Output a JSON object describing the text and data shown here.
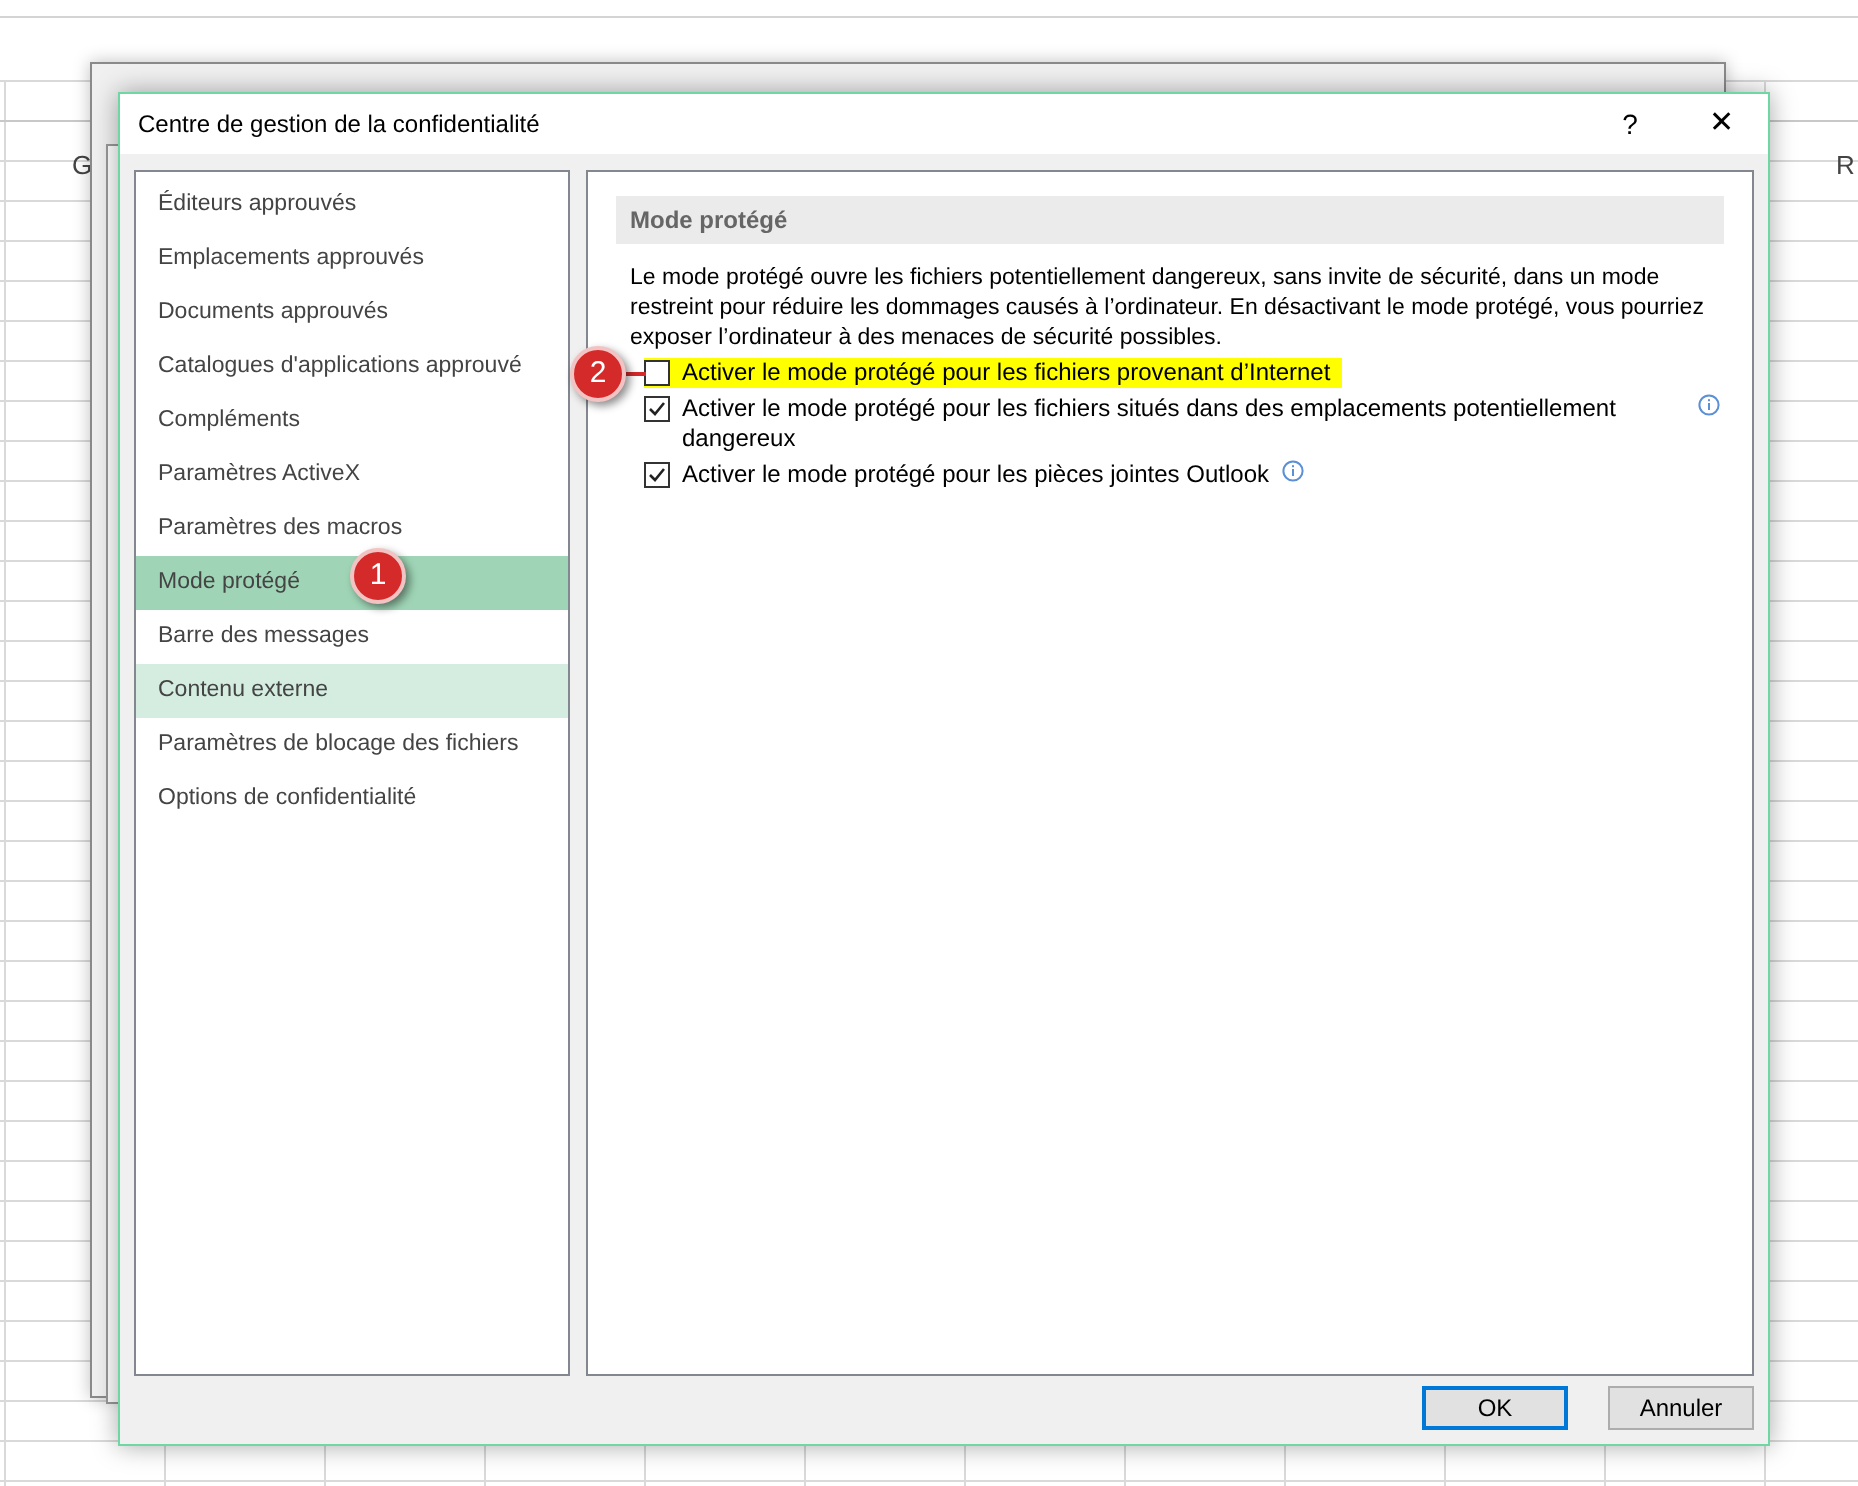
{
  "sheet": {
    "column_headers": [
      "G",
      "R"
    ]
  },
  "dialog": {
    "title": "Centre de gestion de la confidentialité",
    "help": "?",
    "close": "✕"
  },
  "sidebar": {
    "items": [
      {
        "label": "Éditeurs approuvés",
        "selected": false,
        "hovered": false
      },
      {
        "label": "Emplacements approuvés",
        "selected": false,
        "hovered": false
      },
      {
        "label": "Documents approuvés",
        "selected": false,
        "hovered": false
      },
      {
        "label": "Catalogues d'applications approuvé",
        "selected": false,
        "hovered": false
      },
      {
        "label": "Compléments",
        "selected": false,
        "hovered": false
      },
      {
        "label": "Paramètres ActiveX",
        "selected": false,
        "hovered": false
      },
      {
        "label": "Paramètres des macros",
        "selected": false,
        "hovered": false
      },
      {
        "label": "Mode protégé",
        "selected": true,
        "hovered": false
      },
      {
        "label": "Barre des messages",
        "selected": false,
        "hovered": false
      },
      {
        "label": "Contenu externe",
        "selected": false,
        "hovered": true
      },
      {
        "label": "Paramètres de blocage des fichiers",
        "selected": false,
        "hovered": false
      },
      {
        "label": "Options de confidentialité",
        "selected": false,
        "hovered": false
      }
    ]
  },
  "section": {
    "heading": "Mode protégé",
    "description": "Le mode protégé ouvre les fichiers potentiellement dangereux, sans invite de sécurité, dans un mode restreint pour réduire les dommages causés à l’ordinateur. En désactivant le mode protégé, vous pourriez exposer l’ordinateur à des menaces de sécurité possibles.",
    "options": [
      {
        "label": "Activer le mode protégé pour les fichiers provenant d’Internet",
        "checked": false,
        "highlighted": true,
        "kind": "plain"
      },
      {
        "label": "Activer le mode protégé pour les fichiers situés dans des emplacements potentiellement dangereux",
        "checked": true,
        "highlighted": false,
        "kind": "trailing"
      },
      {
        "label": "Activer le mode protégé pour les pièces jointes Outlook",
        "checked": true,
        "highlighted": false,
        "kind": "inline"
      }
    ]
  },
  "buttons": [
    {
      "label": "OK",
      "default": true
    },
    {
      "label": "Annuler",
      "default": false
    }
  ],
  "callouts": [
    {
      "label": "1"
    },
    {
      "label": "2"
    }
  ]
}
